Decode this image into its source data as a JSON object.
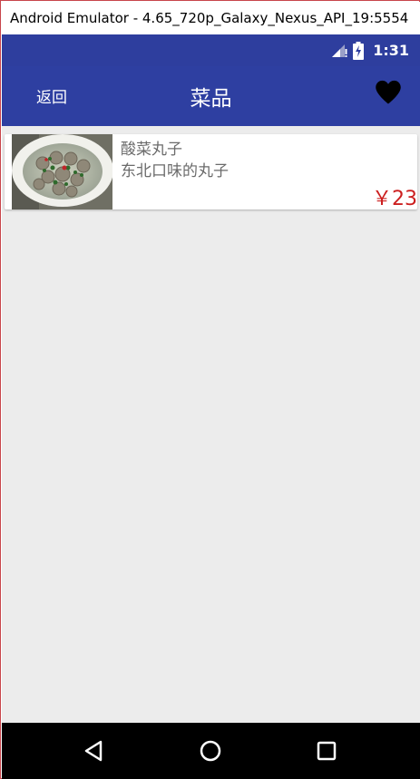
{
  "window": {
    "title": "Android Emulator - 4.65_720p_Galaxy_Nexus_API_19:5554"
  },
  "status_bar": {
    "time": "1:31",
    "icons": [
      "signal-icon",
      "battery-charging-icon"
    ]
  },
  "app_bar": {
    "back_label": "返回",
    "title": "菜品",
    "favorite_icon": "heart-icon"
  },
  "dishes": [
    {
      "name": "酸菜丸子",
      "description": "东北口味的丸子",
      "price": "￥23",
      "image": "meatball-soup-photo"
    }
  ],
  "nav_bar": {
    "buttons": [
      "back-triangle-icon",
      "home-circle-icon",
      "recents-square-icon"
    ]
  },
  "colors": {
    "primary": "#2e3fa1",
    "price": "#cc1f1f",
    "background": "#ececec"
  }
}
